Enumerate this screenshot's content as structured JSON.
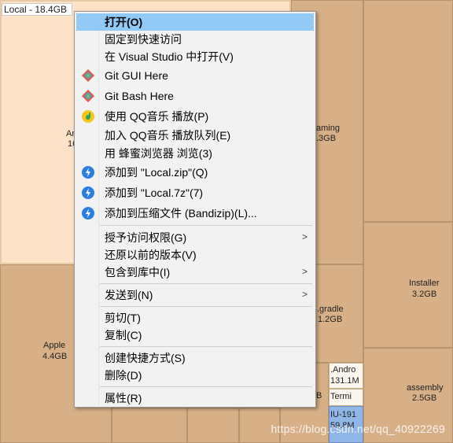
{
  "treemap": {
    "local": {
      "label": "Local - 18.4GB"
    },
    "blocks": [
      {
        "id": "apple",
        "name": "Apple",
        "size": "4.4GB"
      },
      {
        "id": "an",
        "name": "An",
        "size": "16"
      },
      {
        "id": "gaming",
        "name": "aming",
        "size": ".3GB"
      },
      {
        "id": "gradle",
        "name": ".gradle",
        "size": "1.2GB"
      },
      {
        "id": "installer",
        "name": "Installer",
        "size": "3.2GB"
      },
      {
        "id": "assembly",
        "name": "assembly",
        "size": "2.5GB"
      },
      {
        "id": "andro",
        "name": ".Andro",
        "size": "131.1M"
      },
      {
        "id": "termi",
        "name": "Termi",
        "size": ""
      },
      {
        "id": "iu",
        "name": "IU-191",
        "size": "59.8M"
      },
      {
        "id": "b",
        "name": "B",
        "size": ""
      }
    ],
    "watermark": "https://blog.csdn.net/qq_40922269"
  },
  "menu": {
    "items": [
      {
        "label": "打开(O)",
        "icon": "",
        "highlight": true,
        "bold": true
      },
      {
        "label": "固定到快速访问",
        "icon": ""
      },
      {
        "label": "在 Visual Studio 中打开(V)",
        "icon": ""
      },
      {
        "label": "Git GUI Here",
        "icon": "git-icon"
      },
      {
        "label": "Git Bash Here",
        "icon": "git-icon"
      },
      {
        "label": "使用 QQ音乐 播放(P)",
        "icon": "qq-music-icon"
      },
      {
        "label": "加入 QQ音乐 播放队列(E)",
        "icon": ""
      },
      {
        "label": "用 蜂蜜浏览器 浏览(3)",
        "icon": ""
      },
      {
        "label": "添加到 \"Local.zip\"(Q)",
        "icon": "bandizip-icon"
      },
      {
        "label": "添加到 \"Local.7z\"(7)",
        "icon": "bandizip-icon"
      },
      {
        "label": "添加到压缩文件 (Bandizip)(L)...",
        "icon": "bandizip-icon"
      },
      {
        "label": "授予访问权限(G)",
        "icon": "",
        "submenu": true
      },
      {
        "label": "还原以前的版本(V)",
        "icon": ""
      },
      {
        "label": "包含到库中(I)",
        "icon": "",
        "submenu": true
      },
      {
        "label": "发送到(N)",
        "icon": "",
        "submenu": true
      },
      {
        "label": "剪切(T)",
        "icon": ""
      },
      {
        "label": "复制(C)",
        "icon": ""
      },
      {
        "label": "创建快捷方式(S)",
        "icon": ""
      },
      {
        "label": "删除(D)",
        "icon": ""
      },
      {
        "label": "属性(R)",
        "icon": ""
      }
    ],
    "submenu_arrow": ">"
  },
  "colors": {
    "highlight": "#91c9f7",
    "treemap_base": "#d8b088",
    "selected": "#fde2c8"
  }
}
